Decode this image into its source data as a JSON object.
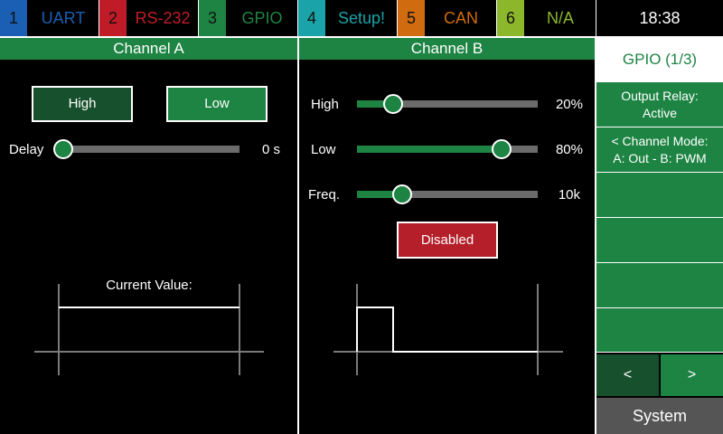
{
  "tabs": [
    {
      "num": "1",
      "label": "UART",
      "num_bg": "#1a5fb4",
      "label_color": "#1a5fb4"
    },
    {
      "num": "2",
      "label": "RS-232",
      "num_bg": "#c01c28",
      "label_color": "#c01c28"
    },
    {
      "num": "3",
      "label": "GPIO",
      "num_bg": "#1e8443",
      "label_color": "#1e8443"
    },
    {
      "num": "4",
      "label": "Setup!",
      "num_bg": "#1aa3a8",
      "label_color": "#1aa3a8"
    },
    {
      "num": "5",
      "label": "CAN",
      "num_bg": "#d06b0f",
      "label_color": "#d06b0f"
    },
    {
      "num": "6",
      "label": "N/A",
      "num_bg": "#8db72a",
      "label_color": "#8db72a"
    }
  ],
  "active_tab": "GPIO",
  "clock": "18:38",
  "channel_a": {
    "header": "Channel A",
    "high_label": "High",
    "low_label": "Low",
    "delay": {
      "label": "Delay",
      "value_text": "0 s",
      "fraction": 0.0
    },
    "current_value_label": "Current Value:"
  },
  "channel_b": {
    "header": "Channel B",
    "high": {
      "label": "High",
      "value_text": "20%",
      "fraction": 0.2
    },
    "low": {
      "label": "Low",
      "value_text": "80%",
      "fraction": 0.8
    },
    "freq": {
      "label": "Freq.",
      "value_text": "10k",
      "fraction": 0.25
    },
    "disabled_label": "Disabled"
  },
  "right_panel": {
    "title": "GPIO (1/3)",
    "output_relay_line1": "Output Relay:",
    "output_relay_line2": "Active",
    "channel_mode_line1": "< Channel Mode:",
    "channel_mode_line2": "A: Out - B: PWM",
    "prev_label": "<",
    "next_label": ">",
    "system_label": "System"
  },
  "colors": {
    "accent_green": "#1e8443",
    "dark_green": "#17502c",
    "disabled_red": "#b41f2a",
    "track_gray": "#6b6b6b"
  }
}
